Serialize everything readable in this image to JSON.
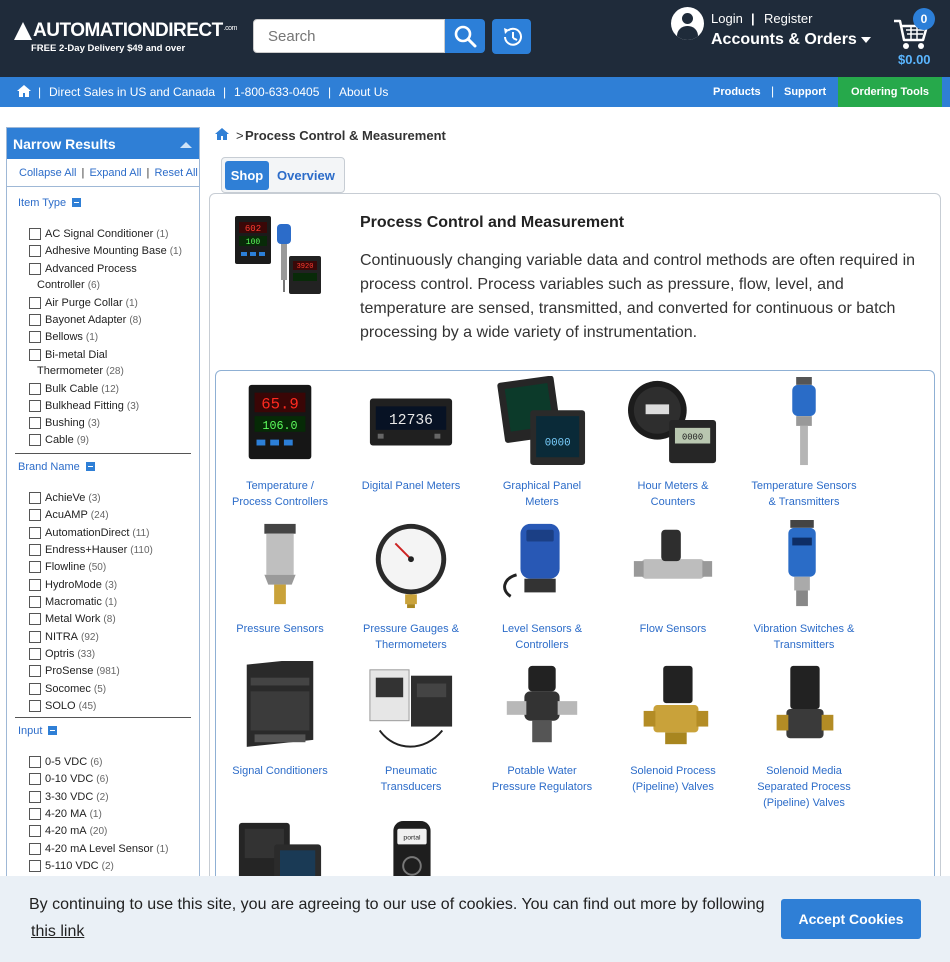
{
  "header": {
    "logo_text": "AUTOMATIONDIRECT",
    "logo_suffix": ".com",
    "logo_tagline": "FREE 2-Day Delivery $49 and over",
    "search_placeholder": "Search",
    "login": "Login",
    "separator": "|",
    "register": "Register",
    "accounts_orders": "Accounts & Orders",
    "cart_count": "0",
    "cart_total": "$0.00",
    "icons": [
      "search-icon",
      "history-icon",
      "account-icon",
      "cart-icon",
      "home-icon"
    ]
  },
  "nav": {
    "sep": "|",
    "direct_sales": "Direct Sales in US and Canada",
    "phone": "1-800-633-0405",
    "about": "About Us",
    "products": "Products",
    "support": "Support",
    "ordering_tools": "Ordering Tools"
  },
  "sidebar": {
    "title": "Narrow Results",
    "collapse_all": "Collapse All",
    "expand_all": "Expand All",
    "reset_all": "Reset All",
    "sep": "|",
    "facets": [
      {
        "title": "Item Type",
        "options": [
          {
            "label": "AC Signal Conditioner",
            "count": "(1)"
          },
          {
            "label": "Adhesive Mounting Base",
            "count": "(1)"
          },
          {
            "label": "Advanced Process",
            "label2": "Controller",
            "count": "(6)"
          },
          {
            "label": "Air Purge Collar",
            "count": "(1)"
          },
          {
            "label": "Bayonet Adapter",
            "count": "(8)"
          },
          {
            "label": "Bellows",
            "count": "(1)"
          },
          {
            "label": "Bi-metal Dial",
            "label2": "Thermometer",
            "count": "(28)"
          },
          {
            "label": "Bulk Cable",
            "count": "(12)"
          },
          {
            "label": "Bulkhead Fitting",
            "count": "(3)"
          },
          {
            "label": "Bushing",
            "count": "(3)"
          },
          {
            "label": "Cable",
            "count": "(9)"
          }
        ]
      },
      {
        "title": "Brand Name",
        "options": [
          {
            "label": "AchieVe",
            "count": "(3)"
          },
          {
            "label": "AcuAMP",
            "count": "(24)"
          },
          {
            "label": "AutomationDirect",
            "count": "(11)"
          },
          {
            "label": "Endress+Hauser",
            "count": "(110)"
          },
          {
            "label": "Flowline",
            "count": "(50)"
          },
          {
            "label": "HydroMode",
            "count": "(3)"
          },
          {
            "label": "Macromatic",
            "count": "(1)"
          },
          {
            "label": "Metal Work",
            "count": "(8)"
          },
          {
            "label": "NITRA",
            "count": "(92)"
          },
          {
            "label": "Optris",
            "count": "(33)"
          },
          {
            "label": "ProSense",
            "count": "(981)"
          },
          {
            "label": "Socomec",
            "count": "(5)"
          },
          {
            "label": "SOLO",
            "count": "(45)"
          }
        ]
      },
      {
        "title": "Input",
        "options": [
          {
            "label": "0-5 VDC",
            "count": "(6)"
          },
          {
            "label": "0-10 VDC",
            "count": "(6)"
          },
          {
            "label": "3-30 VDC",
            "count": "(2)"
          },
          {
            "label": "4-20 MA",
            "count": "(1)"
          },
          {
            "label": "4-20 mA",
            "count": "(20)"
          },
          {
            "label": "4-20 mA Level Sensor",
            "count": "(1)"
          },
          {
            "label": "5-110 VDC",
            "count": "(2)"
          }
        ]
      }
    ]
  },
  "breadcrumb": {
    "gt": ">",
    "current": "Process Control & Measurement"
  },
  "tabs": {
    "shop": "Shop",
    "overview": "Overview"
  },
  "main": {
    "title": "Process Control and Measurement",
    "description": "Continuously changing variable data and control methods are often required in process control. Process variables such as pressure, flow, level, and temperature are sensed, transmitted, and converted for continuous or batch processing by a wide variety of instrumentation."
  },
  "categories": [
    {
      "line1": "Temperature /",
      "line2": "Process Controllers"
    },
    {
      "line1": "Digital Panel Meters",
      "line2": ""
    },
    {
      "line1": "Graphical Panel",
      "line2": "Meters"
    },
    {
      "line1": "Hour Meters &",
      "line2": "Counters"
    },
    {
      "line1": "Temperature Sensors",
      "line2": "& Transmitters"
    },
    {
      "line1": "Pressure Sensors",
      "line2": ""
    },
    {
      "line1": "Pressure Gauges &",
      "line2": "Thermometers"
    },
    {
      "line1": "Level Sensors &",
      "line2": "Controllers"
    },
    {
      "line1": "Flow Sensors",
      "line2": ""
    },
    {
      "line1": "Vibration Switches &",
      "line2": "Transmitters"
    },
    {
      "line1": "Signal Conditioners",
      "line2": ""
    },
    {
      "line1": "Pneumatic",
      "line2": "Transducers"
    },
    {
      "line1": "Potable Water",
      "line2": "Pressure Regulators"
    },
    {
      "line1": "Solenoid Process",
      "line2": "(Pipeline) Valves"
    },
    {
      "line1": "Solenoid Media",
      "line2": "Separated Process",
      "line3": "(Pipeline) Valves"
    }
  ],
  "cookie": {
    "text": "By continuing to use this site, you are agreeing to our use of cookies. You can find out more by following",
    "link": "this link",
    "button": "Accept Cookies"
  },
  "colors": {
    "header_bg": "#1f2b3a",
    "nav_bg": "#2f7fd6",
    "ordering_tools_bg": "#26a94b",
    "link": "#2c6cc9"
  }
}
